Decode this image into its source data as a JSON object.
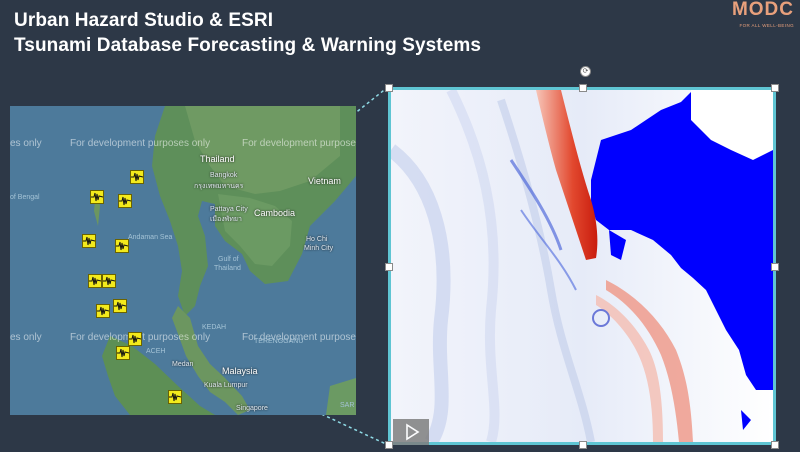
{
  "header": {
    "title_line1": "Urban Hazard Studio & ESRI",
    "title_line2": "Tsunami Database Forecasting & Warning Systems"
  },
  "logo": {
    "word": "MODC",
    "tagline": "FOR ALL WELL-BEING",
    "color": "#e8a07c"
  },
  "map": {
    "watermark": "For development purposes only",
    "watermark_partial": "es only",
    "labels": {
      "thailand": "Thailand",
      "bangkok": "Bangkok",
      "bangkok_thai": "กรุงเทพมหานคร",
      "pattaya": "Pattaya City",
      "pattaya_thai": "เมืองพัทยา",
      "vietnam": "Vietnam",
      "cambodia": "Cambodia",
      "ho_chi_minh": "Ho Chi",
      "ho_chi_minh2": "Minh City",
      "gulf": "Gulf of",
      "gulf2": "Thailand",
      "bengal": "of Bengal",
      "andaman": "Andaman Sea",
      "kedah": "KEDAH",
      "terengganu": "TERENGGANU",
      "aceh": "ACEH",
      "medan": "Medan",
      "malaysia": "Malaysia",
      "kuala_lumpur": "Kuala Lumpur",
      "singapore": "Singapore",
      "sarawak": "SAR"
    },
    "sensor_icon": "seismograph-icon",
    "sensor_color": "#f3ea1c"
  },
  "simulation": {
    "play_icon": "play-icon",
    "rotate_icon": "rotate-handle-icon",
    "selection_color": "#5fc5d3",
    "land_color": "#0000ff",
    "wave_color": "#e03a22"
  }
}
